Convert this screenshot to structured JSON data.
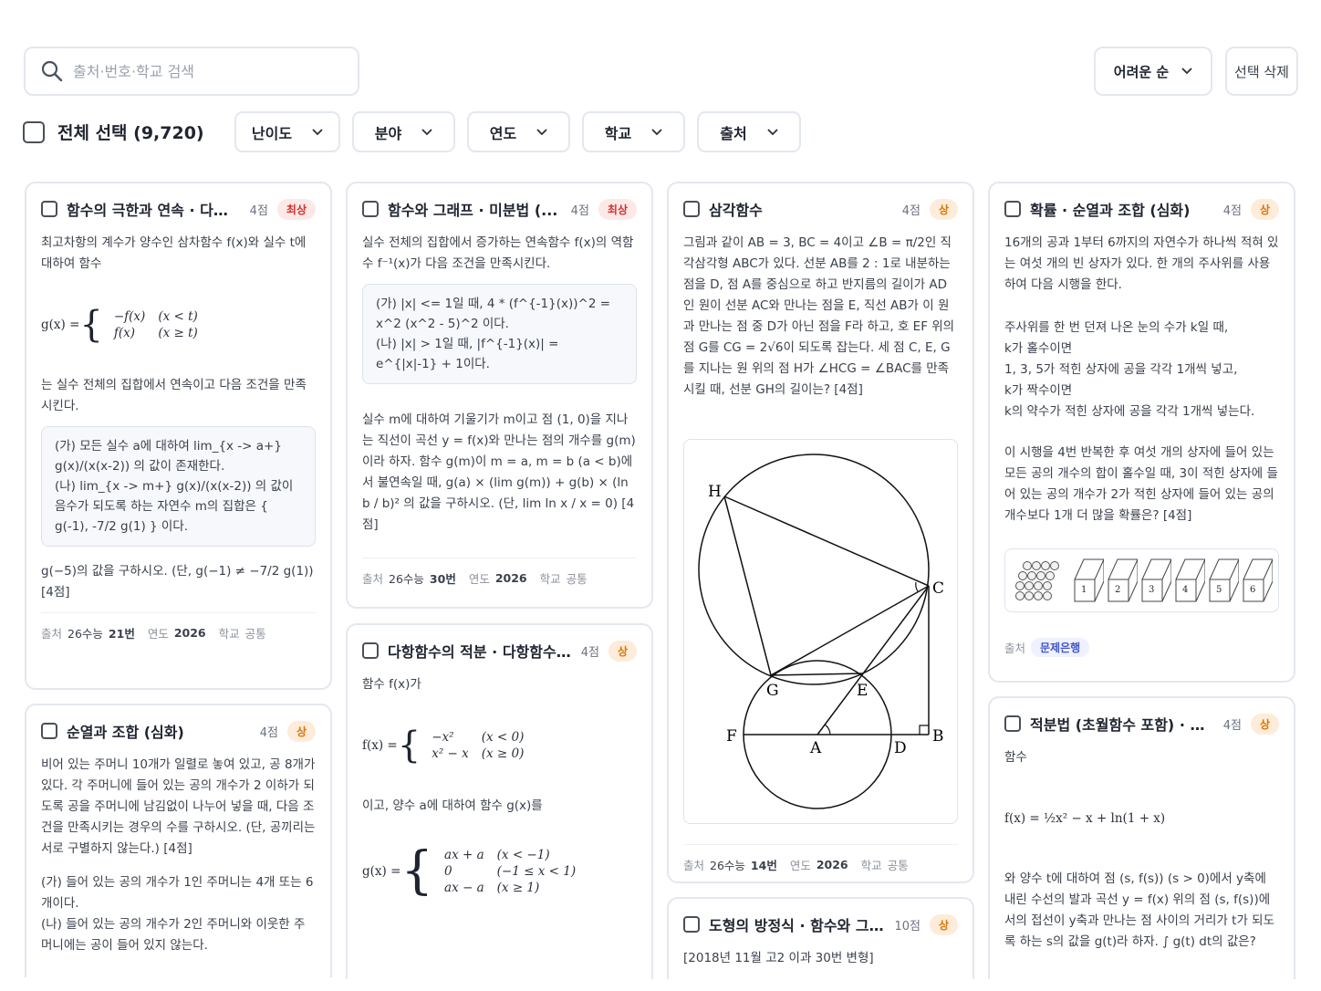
{
  "search": {
    "placeholder": "출처·번호·학교 검색"
  },
  "sort": {
    "label": "어려운 순"
  },
  "toolbar": {
    "delete_label": "선택 삭제",
    "select_all_label": "전체 선택 (9,720)"
  },
  "filters": [
    {
      "label": "난이도"
    },
    {
      "label": "분야"
    },
    {
      "label": "연도"
    },
    {
      "label": "학교"
    },
    {
      "label": "출처"
    }
  ],
  "meta_labels": {
    "source": "출처",
    "year": "연도",
    "school": "학교"
  },
  "cards": {
    "c1": {
      "title": "함수의 극한과 연속 · 다항...",
      "points": "4점",
      "badge": "최상",
      "intro": "최고차항의 계수가 양수인 삼차함수 f(x)와 실수 t에 대하여 함수",
      "after": "는 실수 전체의 집합에서 연속이고 다음 조건을 만족시킨다.",
      "cond_a": "(가) 모든 실수 a에 대하여 lim_{x -> a+} g(x)/(x(x-2)) 의 값이 존재한다.",
      "cond_b": "(나) lim_{x -> m+} g(x)/(x(x-2)) 의 값이 음수가 되도록 하는 자연수 m의 집합은 { g(-1), -7/2 g(1) } 이다.",
      "question": "g(−5)의 값을 구하시오. (단, g(−1) ≠ −7/2 g(1)) [4점]",
      "source": "26수능",
      "number": "21번",
      "year": "2026",
      "school": "공통"
    },
    "c2": {
      "title": "순열과 조합 (심화)",
      "points": "4점",
      "badge": "상",
      "body": "비어 있는 주머니 10개가 일렬로 놓여 있고, 공 8개가 있다. 각 주머니에 들어 있는 공의 개수가 2 이하가 되도록 공을 주머니에 남김없이 나누어 넣을 때, 다음 조건을 만족시키는 경우의 수를 구하시오. (단, 공끼리는 서로 구별하지 않는다.) [4점]",
      "cond_a": "(가) 들어 있는 공의 개수가 1인 주머니는 4개 또는 6개이다.",
      "cond_b": "(나) 들어 있는 공의 개수가 2인 주머니와 이웃한 주머니에는 공이 들어 있지 않는다."
    },
    "c3": {
      "title": "함수와 그래프 · 미분법 (...",
      "points": "4점",
      "badge": "최상",
      "intro": "실수 전체의 집합에서 증가하는 연속함수 f(x)의 역함수 f⁻¹(x)가 다음 조건을 만족시킨다.",
      "cond_a": "(가) |x| <= 1일 때, 4 * (f^{-1}(x))^2 = x^2 (x^2 - 5)^2 이다.",
      "cond_b": "(나) |x| > 1일 때, |f^{-1}(x)| = e^{|x|-1} + 1이다.",
      "body": "실수 m에 대하여 기울기가 m이고 점 (1, 0)을 지나는 직선이 곡선 y = f(x)와 만나는 점의 개수를 g(m)이라 하자. 함수 g(m)이 m = a, m = b (a < b)에서 불연속일 때, g(a) × (lim g(m)) + g(b) × (ln b / b)² 의 값을 구하시오. (단, lim ln x / x = 0) [4점]",
      "source": "26수능",
      "number": "30번",
      "year": "2026",
      "school": "공통"
    },
    "c4": {
      "title": "다항함수의 적분 · 다항함수...",
      "points": "4점",
      "badge": "상",
      "intro": "함수 f(x)가",
      "mid": "이고, 양수 a에 대하여 함수 g(x)를"
    },
    "c5": {
      "title": "삼각함수",
      "points": "4점",
      "badge": "상",
      "body": "그림과 같이 AB = 3, BC = 4이고 ∠B = π/2인 직각삼각형 ABC가 있다. 선분 AB를 2 : 1로 내분하는 점을 D, 점 A를 중심으로 하고 반지름의 길이가 AD인 원이 선분 AC와 만나는 점을 E, 직선 AB가 이 원과 만나는 점 중 D가 아닌 점을 F라 하고, 호 EF 위의 점 G를 CG = 2√6이 되도록 잡는다. 세 점 C, E, G를 지나는 원 위의 점 H가 ∠HCG = ∠BAC를 만족시킬 때, 선분 GH의 길이는? [4점]",
      "source": "26수능",
      "number": "14번",
      "year": "2026",
      "school": "공통",
      "fig_labels": {
        "H": "H",
        "C": "C",
        "G": "G",
        "E": "E",
        "F": "F",
        "A": "A",
        "D": "D",
        "B": "B"
      }
    },
    "c6": {
      "title": "도형의 방정식 · 함수와 그...",
      "points": "10점",
      "badge": "상",
      "body": "[2018년 11월 고2 이과 30번 변형]"
    },
    "c7": {
      "title": "확률 · 순열과 조합 (심화)",
      "points": "4점",
      "badge": "상",
      "body1": "16개의 공과 1부터 6까지의 자연수가 하나씩 적혀 있는 여섯 개의 빈 상자가 있다. 한 개의 주사위를 사용하여 다음 시행을 한다.",
      "rule1": "주사위를 한 번 던져 나온 눈의 수가 k일 때,",
      "rule2": "k가 홀수이면",
      "rule3": "1, 3, 5가 적힌 상자에 공을 각각 1개씩 넣고,",
      "rule4": "k가 짝수이면",
      "rule5": "k의 약수가 적힌 상자에 공을 각각 1개씩 넣는다.",
      "body2": "이 시행을 4번 반복한 후 여섯 개의 상자에 들어 있는 모든 공의 개수의 합이 홀수일 때, 3이 적힌 상자에 들어 있는 공의 개수가 2가 적힌 상자에 들어 있는 공의 개수보다 1개 더 많을 확률은? [4점]",
      "boxes": [
        "1",
        "2",
        "3",
        "4",
        "5",
        "6"
      ],
      "source_chip": "문제은행"
    },
    "c8": {
      "title": "적분법 (초월함수 포함) · 미...",
      "points": "4점",
      "badge": "상",
      "intro": "함수",
      "body": "와 양수 t에 대하여 점 (s, f(s)) (s > 0)에서 y축에 내린 수선의 발과 곡선 y = f(x) 위의 점 (s, f(s))에서의 접선이 y축과 만나는 점 사이의 거리가 t가 되도록 하는 s의 값을 g(t)라 하자. ∫ g(t) dt의 값은?"
    }
  }
}
